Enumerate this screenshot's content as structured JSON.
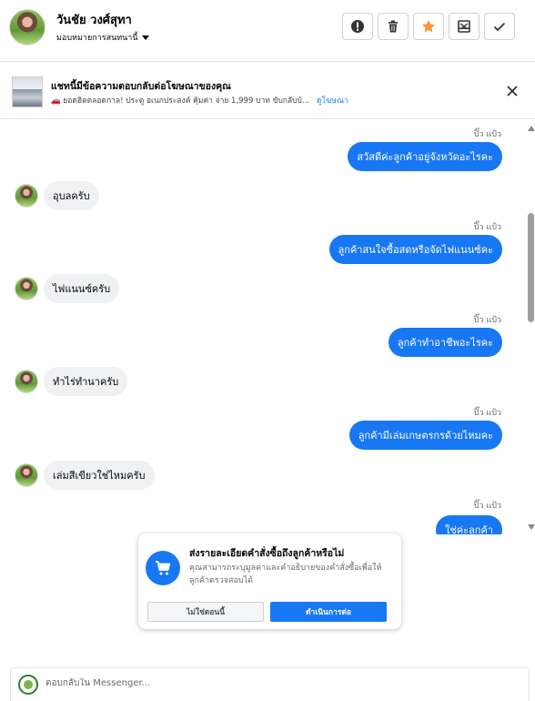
{
  "header": {
    "name": "วันชัย วงศ์สุทา",
    "assign_label": "มอบหมายการสนทนานี้",
    "actions": [
      "alert-icon",
      "trash-icon",
      "star-icon",
      "archive-icon",
      "check-icon"
    ],
    "star_color": "#f7923b"
  },
  "ad": {
    "title": "แชทนี้มีข้อความตอบกลับต่อโฆษณาของคุณ",
    "subtitle": "🚗 ยอดฮิตตลอดกาล! ประตู อเนกประสงค์ คุ้มค่า จ่าย 1,999 บาท ขับกลับบ้...",
    "link": "ดูโฆษณา"
  },
  "messages": [
    {
      "from": "page",
      "seen": "ปิ๊ว แป้ว",
      "text": "สวัสดีค่ะลูกค้าอยู่จังหวัดอะไรคะ"
    },
    {
      "from": "customer",
      "text": "อุบลครับ"
    },
    {
      "from": "page",
      "seen": "ปิ๊ว แป้ว",
      "text": "ลูกค้าสนใจซื้อสดหรือจัดไฟแนนซ์คะ"
    },
    {
      "from": "customer",
      "text": "ไฟแนนซ์ครับ"
    },
    {
      "from": "page",
      "seen": "ปิ๊ว แป้ว",
      "text": "ลูกค้าทำอาชีพอะไรคะ"
    },
    {
      "from": "customer",
      "text": "ทำไร่ทำนาครับ"
    },
    {
      "from": "page",
      "seen": "ปิ๊ว แป้ว",
      "text": "ลูกค้ามีเล่มเกษตรกรด้วยไหมคะ"
    },
    {
      "from": "customer",
      "text": "เล่มสีเขียวใช่ไหมครับ"
    },
    {
      "from": "page",
      "seen": "ปิ๊ว แป้ว",
      "text": "ใช่ค่ะลูกค้า"
    }
  ],
  "popup": {
    "title": "ส่งรายละเอียดคำสั่งซื้อถึงลูกค้าหรือไม่",
    "description": "คุณสามารถระบุมูลค่าและคำอธิบายของคำสั่งซื้อเพื่อให้ลูกค้าตรวจสอบได้",
    "decline": "ไม่ใช่ตอนนี้",
    "accept": "ดำเนินการต่อ",
    "icon": "cart-icon"
  },
  "composer": {
    "placeholder": "ตอบกลับใน Messenger..."
  },
  "colors": {
    "accent": "#1877f2",
    "incoming_bubble": "#eff1f3"
  }
}
